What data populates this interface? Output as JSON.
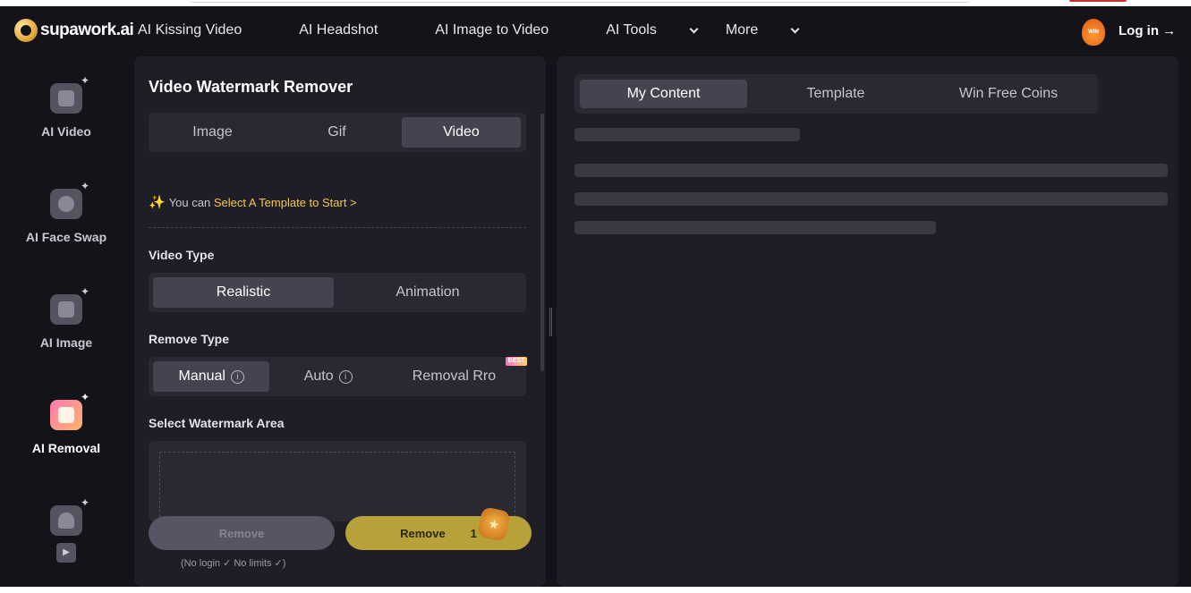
{
  "brand": {
    "logo_text": "supawork.ai"
  },
  "nav": {
    "links": [
      {
        "label": "AI Kissing Video",
        "dropdown": false
      },
      {
        "label": "AI Headshot",
        "dropdown": false
      },
      {
        "label": "AI Image to Video",
        "dropdown": false
      },
      {
        "label": "AI Tools",
        "dropdown": true
      },
      {
        "label": "More",
        "dropdown": true
      }
    ],
    "win_badge": "WIN",
    "login": "Log in →"
  },
  "sidebar": {
    "items": [
      {
        "label": "AI Video",
        "icon": "video-icon",
        "active": false
      },
      {
        "label": "AI Face Swap",
        "icon": "face-swap-icon",
        "active": false
      },
      {
        "label": "AI Image",
        "icon": "image-icon",
        "active": false
      },
      {
        "label": "AI Removal",
        "icon": "eraser-icon",
        "active": true
      },
      {
        "label": "",
        "icon": "avatar-video-icon",
        "active": false
      }
    ]
  },
  "left_panel": {
    "title": "Video Watermark Remover",
    "media_tabs": {
      "options": [
        "Image",
        "Gif",
        "Video"
      ],
      "selected": "Video"
    },
    "tip": {
      "prefix": "You can ",
      "link": "Select A Template to Start >"
    },
    "video_type": {
      "label": "Video Type",
      "options": [
        "Realistic",
        "Animation"
      ],
      "selected": "Realistic"
    },
    "remove_type": {
      "label": "Remove Type",
      "options": [
        "Manual",
        "Auto",
        "Removal Rro"
      ],
      "selected": "Manual",
      "badge": "BEST"
    },
    "watermark_area": {
      "label": "Select Watermark Area"
    },
    "buttons": {
      "remove_free": "Remove",
      "remove_paid": "Remove",
      "paid_cost": "1"
    },
    "fine_print": "(No login ✓ No limits ✓)"
  },
  "right_panel": {
    "tabs": [
      "My Content",
      "Template",
      "Win Free Coins"
    ],
    "selected": "My Content"
  },
  "colors": {
    "accent_gold": "#f2c94c",
    "panel_bg": "#1f1e26",
    "page_bg": "#141319"
  }
}
